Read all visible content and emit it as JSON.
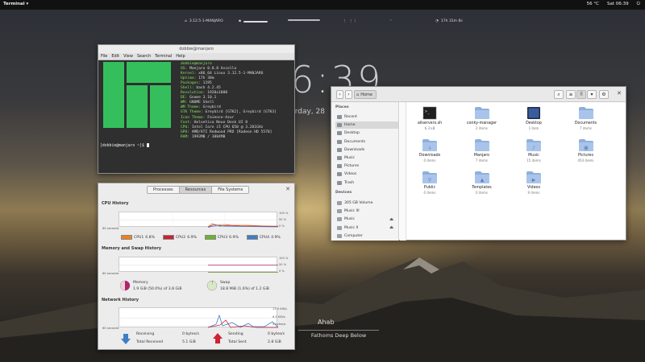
{
  "topbar": {
    "activity": "Terminal ▾",
    "temperature": "56 °C",
    "datetime": "Sat 06:39"
  },
  "conky": {
    "kernel": "3.12.5-1-MANJARO",
    "uptime": "17h 31m 8s"
  },
  "clock": {
    "time": "6:39",
    "date": "urday, 28"
  },
  "terminal": {
    "title": "dobbie@manjaro",
    "menu": [
      "File",
      "Edit",
      "View",
      "Search",
      "Terminal",
      "Help"
    ],
    "header": "dobbie@manjaro",
    "info": [
      {
        "k": "OS:",
        "v": " Manjaro 0.8.8 Ascella"
      },
      {
        "k": "Kernel:",
        "v": " x86_64 Linux 3.12.5-1-MANJARO"
      },
      {
        "k": "Uptime:",
        "v": " 17h 30m"
      },
      {
        "k": "Packages:",
        "v": " 1195"
      },
      {
        "k": "Shell:",
        "v": " bash 4.2.45"
      },
      {
        "k": "Resolution:",
        "v": " 1920x1080"
      },
      {
        "k": "DE:",
        "v": " Gnome 3.10.1"
      },
      {
        "k": "WM:",
        "v": " GNOME Shell"
      },
      {
        "k": "WM Theme:",
        "v": " Greybird"
      },
      {
        "k": "GTK Theme:",
        "v": " Greybird [GTK2], Greybird [GTK3]"
      },
      {
        "k": "Icon Theme:",
        "v": " Faience-Azur"
      },
      {
        "k": "Font:",
        "v": " Helvetica Neue Desk UI 8"
      },
      {
        "k": "CPU:",
        "v": " Intel Core i5 CPU 650 @ 3.201GHz"
      },
      {
        "k": "GPU:",
        "v": " AMD/ATI Redwood PRO [Radeon HD 5570]"
      },
      {
        "k": "RAM:",
        "v": " 1993MB / 3884MB"
      }
    ],
    "prompt": "[dobbie@manjaro ~]$ "
  },
  "sysmon": {
    "tabs": [
      "Processes",
      "Resources",
      "File Systems"
    ],
    "active_tab": 1,
    "cpu_title": "CPU History",
    "mem_title": "Memory and Swap History",
    "net_title": "Network History",
    "seconds_label": "60 seconds",
    "cpu_y": [
      "100 %",
      "50 %",
      "0 %"
    ],
    "mem_y": [
      "100 %",
      "50 %",
      "0 %"
    ],
    "net_y": [
      "13.0 KiB/s",
      "6.5 KiB/s",
      "0 bytes/s"
    ],
    "cpus": [
      {
        "label": "CPU1",
        "value": "6.8%",
        "color": "#ef7f1f"
      },
      {
        "label": "CPU2",
        "value": "6.9%",
        "color": "#cc2233"
      },
      {
        "label": "CPU3",
        "value": "6.9%",
        "color": "#6ab42f"
      },
      {
        "label": "CPU4",
        "value": "4.9%",
        "color": "#3d7fc5"
      }
    ],
    "memory_label": "Memory",
    "memory_value": "1.9 GiB (50.0%) of 3.8 GiB",
    "memory_fraction": 0.5,
    "swap_label": "Swap",
    "swap_value": "18.8 MiB (1.6%) of 1.2 GiB",
    "swap_fraction": 0.016,
    "receiving_label": "Receiving",
    "receiving_value": "0 bytes/s",
    "total_received_label": "Total Received",
    "total_received_value": "5.1 GiB",
    "sending_label": "Sending",
    "sending_value": "0 bytes/s",
    "total_sent_label": "Total Sent",
    "total_sent_value": "2.8 GiB"
  },
  "files": {
    "location": "Home",
    "sidebar_places_title": "Places",
    "sidebar_devices_title": "Devices",
    "places": [
      "Recent",
      "Home",
      "Desktop",
      "Documents",
      "Downloads",
      "Music",
      "Pictures",
      "Videos",
      "Trash"
    ],
    "selected_place": 1,
    "devices": [
      "305 GB Volume",
      "Music III",
      "Music",
      "Music II",
      "Computer"
    ],
    "items": [
      {
        "name": "aliservers.sh",
        "size": "6.3 kB",
        "kind": "script"
      },
      {
        "name": "conky-manager",
        "size": "2 items",
        "kind": "folder"
      },
      {
        "name": "Desktop",
        "size": "1 item",
        "kind": "desktop"
      },
      {
        "name": "Documents",
        "size": "7 items",
        "kind": "folder"
      },
      {
        "name": "Downloads",
        "size": "0 items",
        "kind": "downloads"
      },
      {
        "name": "Manjaro",
        "size": "7 items",
        "kind": "folder"
      },
      {
        "name": "Music",
        "size": "15 items",
        "kind": "music"
      },
      {
        "name": "Pictures",
        "size": "454 items",
        "kind": "pictures"
      },
      {
        "name": "Public",
        "size": "0 items",
        "kind": "public"
      },
      {
        "name": "Templates",
        "size": "0 items",
        "kind": "templates"
      },
      {
        "name": "Videos",
        "size": "9 items",
        "kind": "videos"
      }
    ]
  },
  "music": {
    "title": "Ahab",
    "album": "Fathoms Deep Below"
  }
}
